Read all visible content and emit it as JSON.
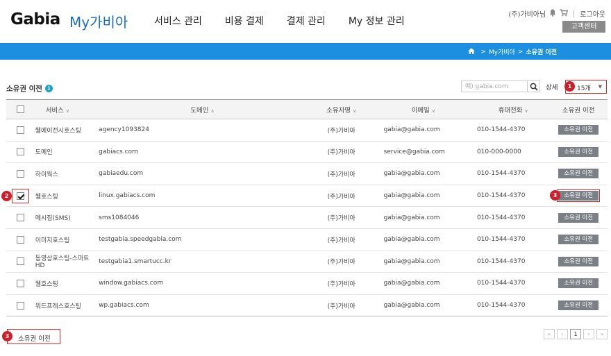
{
  "header": {
    "logo": "Gabia",
    "brand": "My가비아",
    "nav": [
      "서비스 관리",
      "비용 결제",
      "결제 관리",
      "My 정보 관리"
    ],
    "user": "(주)가비아님",
    "logout": "로그아웃",
    "customer_center": "고객센터"
  },
  "breadcrumb": {
    "level1": "My가비아",
    "current": "소유권 이전"
  },
  "page": {
    "title": "소유권 이전",
    "search_placeholder": "예) gabia.com",
    "detail_label": "상세",
    "page_size": "15개"
  },
  "table": {
    "headers": {
      "service": "서비스",
      "domain": "도메인",
      "owner": "소유자명",
      "email": "이메일",
      "phone": "휴대전화",
      "action": "소유권 이전"
    },
    "rows": [
      {
        "checked": false,
        "service": "웹에이전시호스팅",
        "domain": "agency1093824",
        "owner": "(주)가비아",
        "email": "gabia@gabia.com",
        "phone": "010-1544-4370",
        "action": "소유권 이전"
      },
      {
        "checked": false,
        "service": "도메인",
        "domain": "gabiacs.com",
        "owner": "(주)가비아",
        "email": "service@gabia.com",
        "phone": "010-000-0000",
        "action": "소유권 이전"
      },
      {
        "checked": false,
        "service": "하이웍스",
        "domain": "gabiaedu.com",
        "owner": "(주)가비아",
        "email": "gabia@gabia.com",
        "phone": "010-1544-4370",
        "action": "소유권 이전"
      },
      {
        "checked": true,
        "service": "웹호스팅",
        "domain": "linux.gabiacs.com",
        "owner": "(주)가비아",
        "email": "gabia@gabia.com",
        "phone": "010-1544-4370",
        "action": "소유권 이전"
      },
      {
        "checked": false,
        "service": "메시징(SMS)",
        "domain": "sms1084046",
        "owner": "(주)가비아",
        "email": "gabia@gabia.com",
        "phone": "010-1544-4370",
        "action": "소유권 이전"
      },
      {
        "checked": false,
        "service": "이미지호스팅",
        "domain": "testgabia.speedgabia.com",
        "owner": "(주)가비아",
        "email": "gabia@gabia.com",
        "phone": "010-1544-4370",
        "action": "소유권 이전"
      },
      {
        "checked": false,
        "service": "동영상호스팅-스마트HD",
        "domain": "testgabia1.smartucc.kr",
        "owner": "(주)가비아",
        "email": "gabia@gabia.com",
        "phone": "010-1544-4370",
        "action": "소유권 이전"
      },
      {
        "checked": false,
        "service": "웹호스팅",
        "domain": "window.gabiacs.com",
        "owner": "(주)가비아",
        "email": "gabia@gabia.com",
        "phone": "010-1544-4370",
        "action": "소유권 이전"
      },
      {
        "checked": false,
        "service": "워드프레스호스팅",
        "domain": "wp.gabiacs.com",
        "owner": "(주)가비아",
        "email": "gabia@gabia.com",
        "phone": "010-1544-4370",
        "action": "소유권 이전"
      }
    ]
  },
  "annotations": [
    "1",
    "2",
    "3",
    "3"
  ],
  "bottom": {
    "transfer_button": "소유권 이전"
  },
  "pagination": {
    "first": "«",
    "prev": "‹",
    "current": "1",
    "next": "›",
    "last": "»"
  },
  "colors": {
    "accent_blue": "#1d8fe1",
    "highlight_red": "#e02a2a"
  }
}
